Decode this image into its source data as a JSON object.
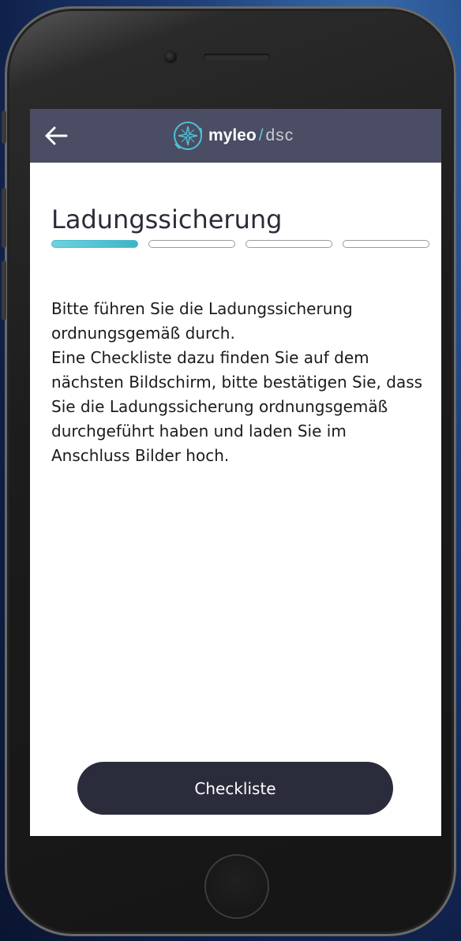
{
  "device": {
    "type": "smartphone",
    "frame_color": "#1c1c1c"
  },
  "header": {
    "back_icon": "arrow-left-icon",
    "logo": {
      "icon": "compass-star-icon",
      "brand": "myleo",
      "separator": "/",
      "sub": "dsc"
    },
    "background": "#4a4d63"
  },
  "page": {
    "title": "Ladungssicherung",
    "progress": {
      "total_steps": 4,
      "current_step": 1,
      "active_color": "#4bbccd"
    },
    "paragraphs": [
      "Bitte führen Sie die Ladungssicherung ordnungsgemäß durch.",
      "Eine Checkliste dazu finden Sie auf dem nächsten Bildschirm, bitte bestätigen Sie, dass Sie die Ladungssicherung ordnungsgemäß durchgeführt haben und laden Sie im Anschluss Bilder hoch."
    ]
  },
  "actions": {
    "primary_label": "Checkliste",
    "primary_color": "#2b2c3b"
  }
}
